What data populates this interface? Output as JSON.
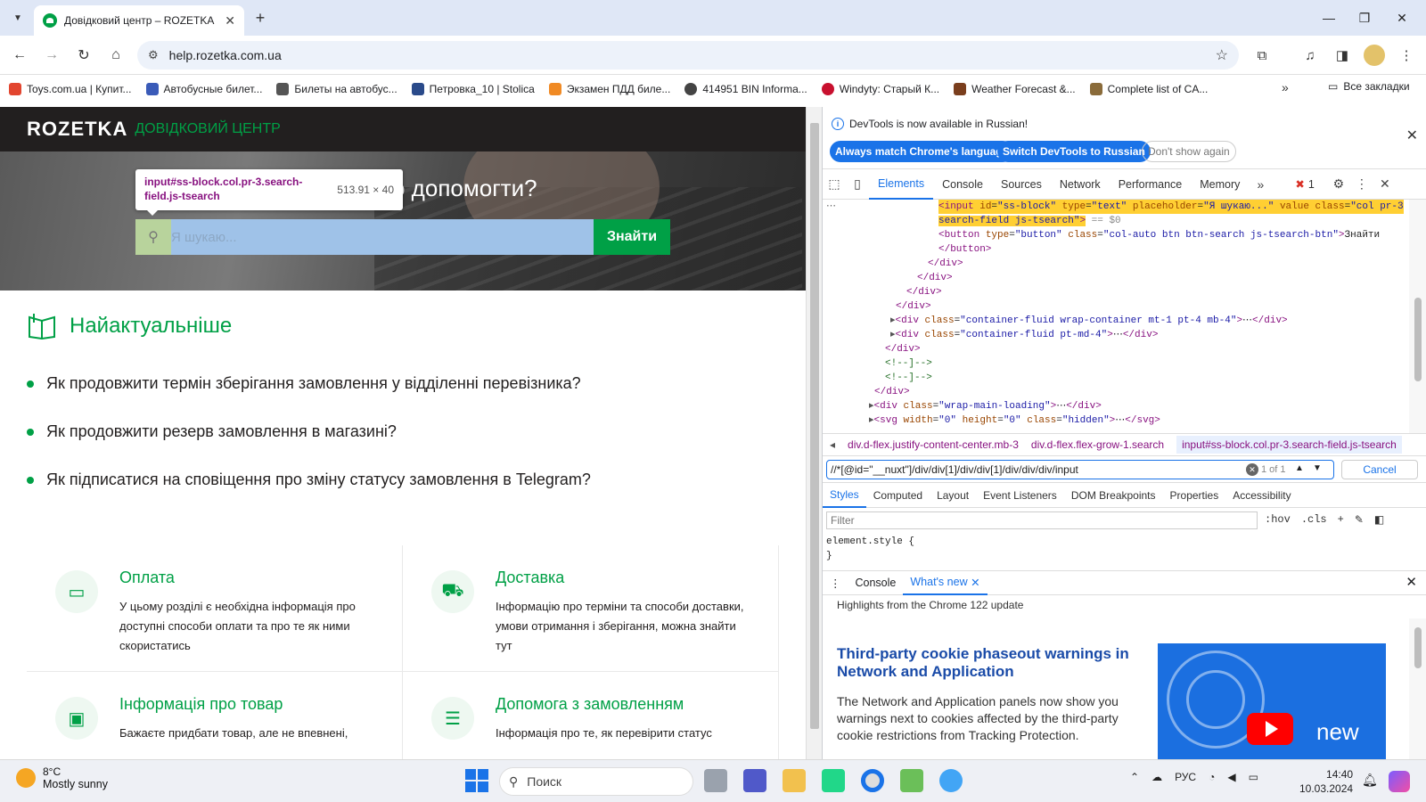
{
  "browser": {
    "tab_title": "Довідковий центр – ROZETKA",
    "url": "help.rozetka.com.ua",
    "bookmarks": [
      "Toys.com.ua | Купит...",
      "Автобусные билет...",
      "Билеты на автобус...",
      "Петровка_10 | Stolica",
      "Экзамен ПДД биле...",
      "414951 BIN Informa...",
      "Windyty: Старый К...",
      "Weather Forecast &...",
      "Complete list of CA..."
    ],
    "all_bookmarks": "Все закладки"
  },
  "page": {
    "logo": "ROZETKA",
    "logo_sub": "ДОВІДКОВИЙ ЦЕНТР",
    "hero_title": "о допомогти?",
    "tooltip_selector": "input#ss-block.col.pr-3.search-field.js-tsearch",
    "tooltip_size": "513.91 × 40",
    "search_placeholder": "Я шукаю...",
    "search_button": "Знайти",
    "top_heading": "Найактуальніше",
    "questions": [
      "Як продовжити термін зберігання замовлення у відділенні перевізника?",
      "Як продовжити резерв замовлення в магазині?",
      "Як підписатися на сповіщення про зміну статусу замовлення в Telegram?"
    ],
    "cards": [
      {
        "title": "Оплата",
        "desc": "У цьому розділі є необхідна інформація про доступні способи оплати та про те як ними скористатись",
        "icon": "card-icon"
      },
      {
        "title": "Доставка",
        "desc": "Інформацію про терміни та способи доставки, умови отримання і зберігання, можна знайти тут",
        "icon": "truck-icon"
      },
      {
        "title": "Інформація про товар",
        "desc": "Бажаєте придбати товар, але не впевнені,",
        "icon": "box-icon"
      },
      {
        "title": "Допомога з замовленням",
        "desc": "Інформація про те, як перевірити статус",
        "icon": "list-icon"
      }
    ]
  },
  "devtools": {
    "banner_msg": "DevTools is now available in Russian!",
    "btn_match": "Always match Chrome's language",
    "btn_switch": "Switch DevTools to Russian",
    "btn_dont": "Don't show again",
    "tabs": [
      "Elements",
      "Console",
      "Sources",
      "Network",
      "Performance",
      "Memory"
    ],
    "error_count": "1",
    "breadcrumbs": [
      "div.d-flex.justify-content-center.mb-3",
      "div.d-flex.flex-grow-1.search",
      "input#ss-block.col.pr-3.search-field.js-tsearch"
    ],
    "xpath": "//*[@id=\"__nuxt\"]/div/div[1]/div/div[1]/div/div/div/input",
    "xpath_count": "1 of 1",
    "cancel": "Cancel",
    "style_tabs": [
      "Styles",
      "Computed",
      "Layout",
      "Event Listeners",
      "DOM Breakpoints",
      "Properties",
      "Accessibility"
    ],
    "filter_placeholder": "Filter",
    "hov": ":hov",
    "cls": ".cls",
    "element_style": "element.style {",
    "element_style_close": "}",
    "drawer_tabs": [
      "Console",
      "What's new"
    ],
    "highlights": "Highlights from the Chrome 122 update",
    "wn_title": "Third-party cookie phaseout warnings in Network and Application",
    "wn_body": "The Network and Application panels now show you warnings next to cookies affected by the third-party cookie restrictions from Tracking Protection.",
    "wn_new": "new"
  },
  "taskbar": {
    "temp": "8°C",
    "weather": "Mostly sunny",
    "search": "Поиск",
    "lang": "РУС",
    "time": "14:40",
    "date": "10.03.2024"
  }
}
